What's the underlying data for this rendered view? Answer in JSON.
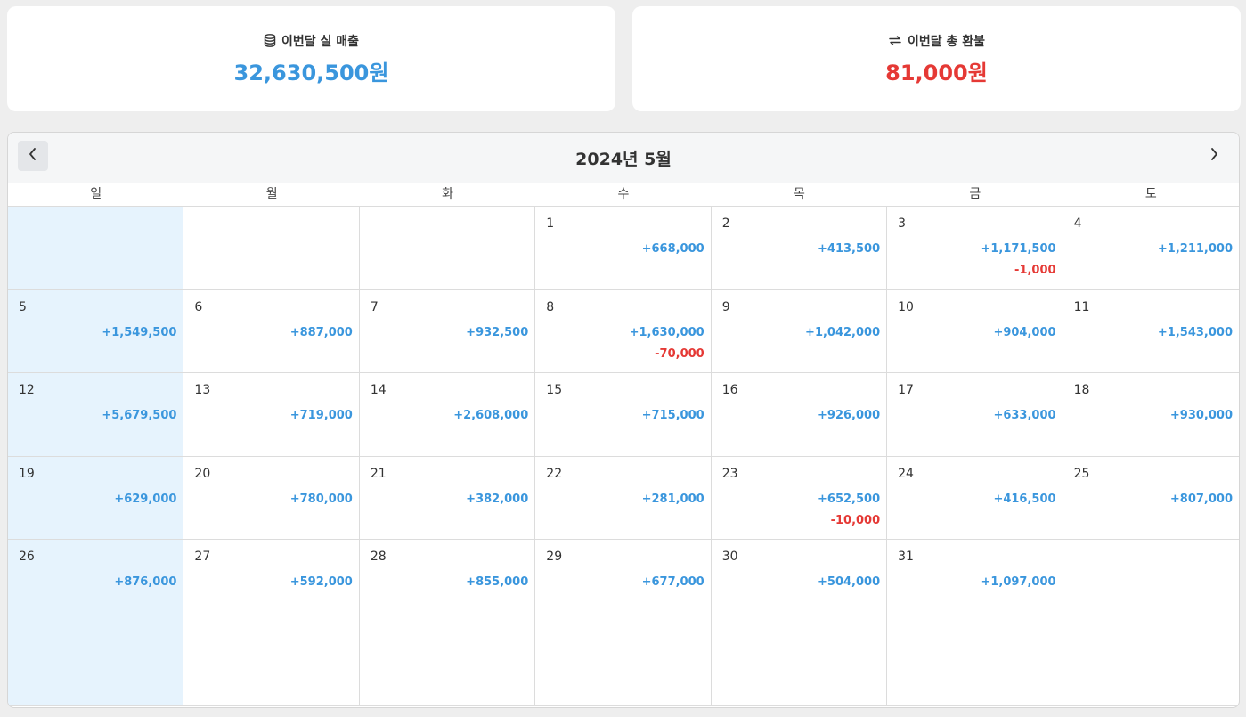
{
  "summary": {
    "sales_label": "이번달 실 매출",
    "sales_value": "32,630,500원",
    "refund_label": "이번달 총 환불",
    "refund_value": "81,000원",
    "sales_icon": "database-icon",
    "refund_icon": "exchange-icon",
    "sales_color": "#3a96dd",
    "refund_color": "#e53935"
  },
  "calendar": {
    "title": "2024년 5월",
    "prev_icon": "chevron-left-icon",
    "next_icon": "chevron-right-icon",
    "weekdays": [
      "일",
      "월",
      "화",
      "수",
      "목",
      "금",
      "토"
    ],
    "weeks": [
      [
        {
          "day": "",
          "income": "",
          "refund": ""
        },
        {
          "day": "",
          "income": "",
          "refund": ""
        },
        {
          "day": "",
          "income": "",
          "refund": ""
        },
        {
          "day": "1",
          "income": "+668,000",
          "refund": ""
        },
        {
          "day": "2",
          "income": "+413,500",
          "refund": ""
        },
        {
          "day": "3",
          "income": "+1,171,500",
          "refund": "-1,000"
        },
        {
          "day": "4",
          "income": "+1,211,000",
          "refund": ""
        }
      ],
      [
        {
          "day": "5",
          "income": "+1,549,500",
          "refund": ""
        },
        {
          "day": "6",
          "income": "+887,000",
          "refund": ""
        },
        {
          "day": "7",
          "income": "+932,500",
          "refund": ""
        },
        {
          "day": "8",
          "income": "+1,630,000",
          "refund": "-70,000"
        },
        {
          "day": "9",
          "income": "+1,042,000",
          "refund": ""
        },
        {
          "day": "10",
          "income": "+904,000",
          "refund": ""
        },
        {
          "day": "11",
          "income": "+1,543,000",
          "refund": ""
        }
      ],
      [
        {
          "day": "12",
          "income": "+5,679,500",
          "refund": ""
        },
        {
          "day": "13",
          "income": "+719,000",
          "refund": ""
        },
        {
          "day": "14",
          "income": "+2,608,000",
          "refund": ""
        },
        {
          "day": "15",
          "income": "+715,000",
          "refund": ""
        },
        {
          "day": "16",
          "income": "+926,000",
          "refund": ""
        },
        {
          "day": "17",
          "income": "+633,000",
          "refund": ""
        },
        {
          "day": "18",
          "income": "+930,000",
          "refund": ""
        }
      ],
      [
        {
          "day": "19",
          "income": "+629,000",
          "refund": ""
        },
        {
          "day": "20",
          "income": "+780,000",
          "refund": ""
        },
        {
          "day": "21",
          "income": "+382,000",
          "refund": ""
        },
        {
          "day": "22",
          "income": "+281,000",
          "refund": ""
        },
        {
          "day": "23",
          "income": "+652,500",
          "refund": "-10,000"
        },
        {
          "day": "24",
          "income": "+416,500",
          "refund": ""
        },
        {
          "day": "25",
          "income": "+807,000",
          "refund": ""
        }
      ],
      [
        {
          "day": "26",
          "income": "+876,000",
          "refund": ""
        },
        {
          "day": "27",
          "income": "+592,000",
          "refund": ""
        },
        {
          "day": "28",
          "income": "+855,000",
          "refund": ""
        },
        {
          "day": "29",
          "income": "+677,000",
          "refund": ""
        },
        {
          "day": "30",
          "income": "+504,000",
          "refund": ""
        },
        {
          "day": "31",
          "income": "+1,097,000",
          "refund": ""
        },
        {
          "day": "",
          "income": "",
          "refund": ""
        }
      ],
      [
        {
          "day": "",
          "income": "",
          "refund": ""
        },
        {
          "day": "",
          "income": "",
          "refund": ""
        },
        {
          "day": "",
          "income": "",
          "refund": ""
        },
        {
          "day": "",
          "income": "",
          "refund": ""
        },
        {
          "day": "",
          "income": "",
          "refund": ""
        },
        {
          "day": "",
          "income": "",
          "refund": ""
        },
        {
          "day": "",
          "income": "",
          "refund": ""
        }
      ]
    ],
    "sunday_bg": "#e6f3fd",
    "income_color": "#3a96dd",
    "refund_color": "#e53935"
  }
}
